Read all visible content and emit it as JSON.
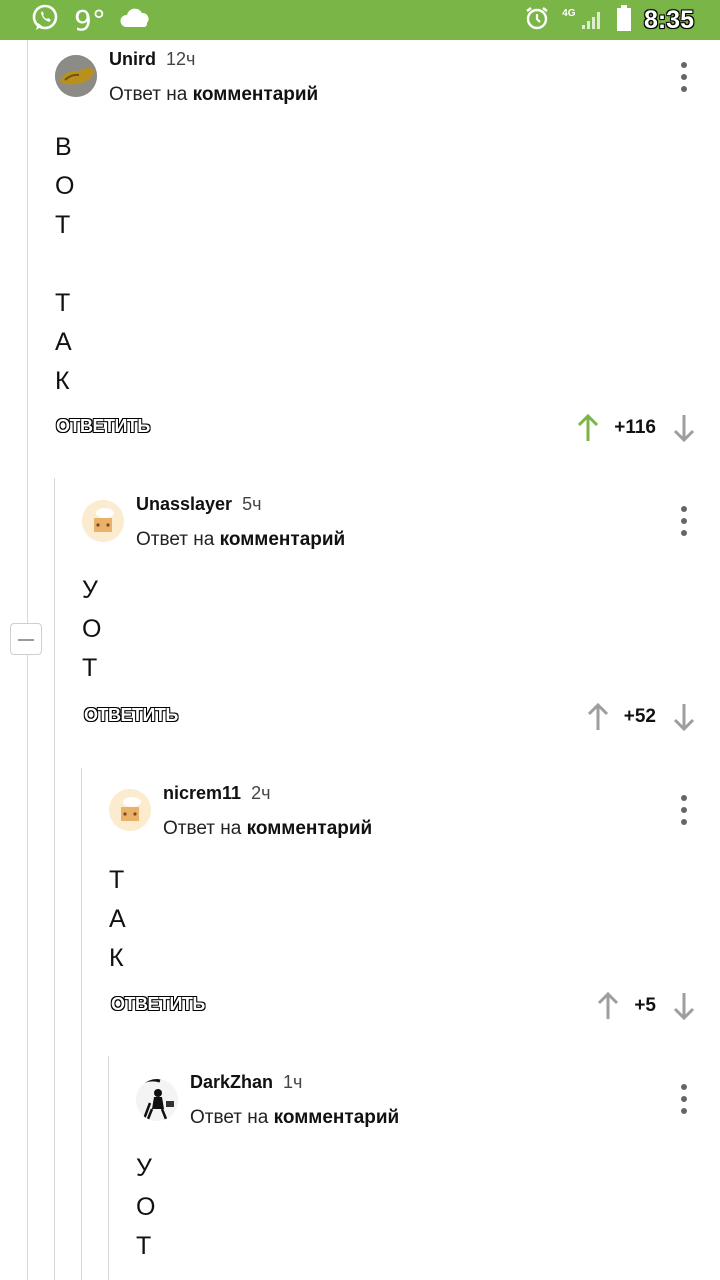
{
  "status_bar": {
    "temperature": "9°",
    "network": "4G",
    "time": "8:35",
    "icons": [
      "whatsapp-icon",
      "cloud-icon",
      "alarm-icon",
      "signal-icon",
      "battery-icon"
    ]
  },
  "comments": [
    {
      "author": "Unird",
      "time": "12ч",
      "reply_prefix": "Ответ на",
      "reply_target": "комментарий",
      "body_lines": [
        "В",
        "О",
        "Т",
        "",
        "Т",
        "А",
        "К"
      ],
      "reply_label": "ОТВЕТИТЬ",
      "score": "+116",
      "upvoted": true
    },
    {
      "author": "Unasslayer",
      "time": "5ч",
      "reply_prefix": "Ответ на",
      "reply_target": "комментарий",
      "body_lines": [
        "У",
        "О",
        "Т"
      ],
      "reply_label": "ОТВЕТИТЬ",
      "score": "+52",
      "upvoted": false
    },
    {
      "author": "nicrem11",
      "time": "2ч",
      "reply_prefix": "Ответ на",
      "reply_target": "комментарий",
      "body_lines": [
        "Т",
        "А",
        "К"
      ],
      "reply_label": "ОТВЕТИТЬ",
      "score": "+5",
      "upvoted": false
    },
    {
      "author": "DarkZhan",
      "time": "1ч",
      "reply_prefix": "Ответ на",
      "reply_target": "комментарий",
      "body_lines": [
        "У",
        "О",
        "Т"
      ]
    }
  ],
  "colors": {
    "status_bar": "#7ab547",
    "upvote_active": "#7ab547",
    "vote_inactive": "#9e9e9e"
  }
}
